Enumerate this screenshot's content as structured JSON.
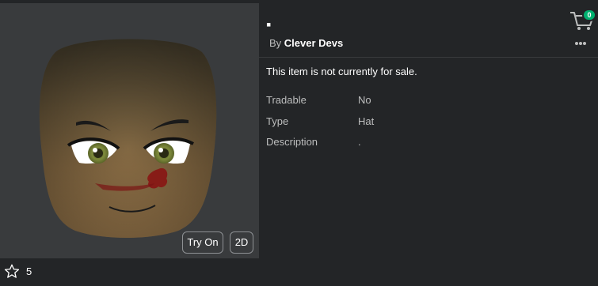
{
  "item": {
    "title": "▪",
    "creator_prefix": "By",
    "creator_name": "Clever Devs",
    "sale_note": "This item is not currently for sale."
  },
  "details": [
    {
      "label": "Tradable",
      "value": "No"
    },
    {
      "label": "Type",
      "value": "Hat"
    },
    {
      "label": "Description",
      "value": "."
    }
  ],
  "preview": {
    "try_on_label": "Try On",
    "view_2d_label": "2D"
  },
  "favorites": {
    "count": "5",
    "icon": "star-outline-icon"
  },
  "cart": {
    "count": "0",
    "icon": "cart-icon",
    "badge_color": "#00b06f"
  },
  "more_icon": "more-dots-icon",
  "colors": {
    "background": "#232527",
    "panel": "#393b3d",
    "accent_green": "#00b06f",
    "secondary_text": "#bdbebe"
  }
}
